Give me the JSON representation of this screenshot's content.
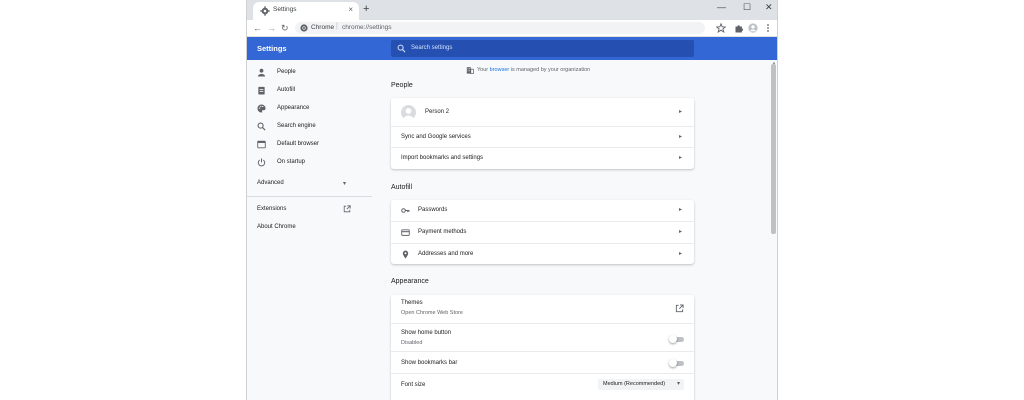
{
  "tab": {
    "title": "Settings",
    "close": "×",
    "new_tab": "+"
  },
  "window_controls": {
    "minimize": "—",
    "maximize": "☐",
    "close": "✕"
  },
  "toolbar": {
    "back": "←",
    "forward": "→",
    "reload": "↻",
    "origin": "Chrome",
    "separator": "|",
    "url": "chrome://settings"
  },
  "header": {
    "title": "Settings",
    "search_placeholder": "Search settings"
  },
  "sidebar": {
    "items": [
      {
        "label": "People",
        "icon": "person-icon"
      },
      {
        "label": "Autofill",
        "icon": "clipboard-icon"
      },
      {
        "label": "Appearance",
        "icon": "palette-icon"
      },
      {
        "label": "Search engine",
        "icon": "search-icon"
      },
      {
        "label": "Default browser",
        "icon": "browser-icon"
      },
      {
        "label": "On startup",
        "icon": "power-icon"
      }
    ],
    "advanced": {
      "label": "Advanced",
      "caret": "▾"
    },
    "extensions": "Extensions",
    "about": "About Chrome"
  },
  "main": {
    "managed": {
      "prefix": "Your ",
      "link": "browser",
      "suffix": " is managed by your organization"
    },
    "people": {
      "title": "People",
      "person": "Person 2",
      "sync": "Sync and Google services",
      "import": "Import bookmarks and settings"
    },
    "autofill": {
      "title": "Autofill",
      "passwords": "Passwords",
      "payment": "Payment methods",
      "addresses": "Addresses and more"
    },
    "appearance": {
      "title": "Appearance",
      "themes": "Themes",
      "themes_sub": "Open Chrome Web Store",
      "home_button": "Show home button",
      "home_button_sub": "Disabled",
      "bookmarks_bar": "Show bookmarks bar",
      "font_size": "Font size",
      "font_size_value": "Medium (Recommended)"
    },
    "arrow": "▸"
  },
  "colors": {
    "header_blue": "#3367d6",
    "link_blue": "#1a73e8"
  }
}
